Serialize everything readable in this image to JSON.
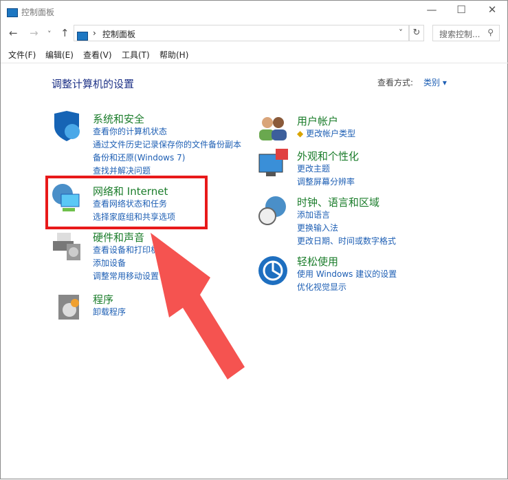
{
  "window": {
    "title": "控制面板",
    "minimize": "—",
    "maximize": "☐",
    "close": "✕"
  },
  "nav": {
    "back": "←",
    "forward": "→",
    "recent": "˅",
    "up": "↑",
    "breadcrumb_sep": "›",
    "breadcrumb": "控制面板",
    "dropdown": "˅",
    "refresh": "↻",
    "search_placeholder": "搜索控制...",
    "search_icon": "⚲"
  },
  "menu": [
    "文件(F)",
    "编辑(E)",
    "查看(V)",
    "工具(T)",
    "帮助(H)"
  ],
  "main": {
    "heading": "调整计算机的设置",
    "view_by_label": "查看方式:",
    "view_by_value": "类别 ▾"
  },
  "left": [
    {
      "title": "系统和安全",
      "links": [
        "查看你的计算机状态",
        "通过文件历史记录保存你的文件备份副本",
        "备份和还原(Windows 7)",
        "查找并解决问题"
      ]
    },
    {
      "title": "网络和 Internet",
      "links": [
        "查看网络状态和任务",
        "选择家庭组和共享选项"
      ]
    },
    {
      "title": "硬件和声音",
      "links": [
        "查看设备和打印机",
        "添加设备",
        "调整常用移动设置"
      ]
    },
    {
      "title": "程序",
      "links": [
        "卸载程序"
      ]
    }
  ],
  "right": [
    {
      "title": "用户帐户",
      "links": [
        "更改帐户类型"
      ]
    },
    {
      "title": "外观和个性化",
      "links": [
        "更改主题",
        "调整屏幕分辨率"
      ]
    },
    {
      "title": "时钟、语言和区域",
      "links": [
        "添加语言",
        "更换输入法",
        "更改日期、时间或数字格式"
      ]
    },
    {
      "title": "轻松使用",
      "links": [
        "使用 Windows 建议的设置",
        "优化视觉显示"
      ]
    }
  ],
  "colors": {
    "highlight": "#e8191a",
    "arrow": "#f55350",
    "category": "#1a7c2a",
    "link": "#1e5fb4"
  }
}
